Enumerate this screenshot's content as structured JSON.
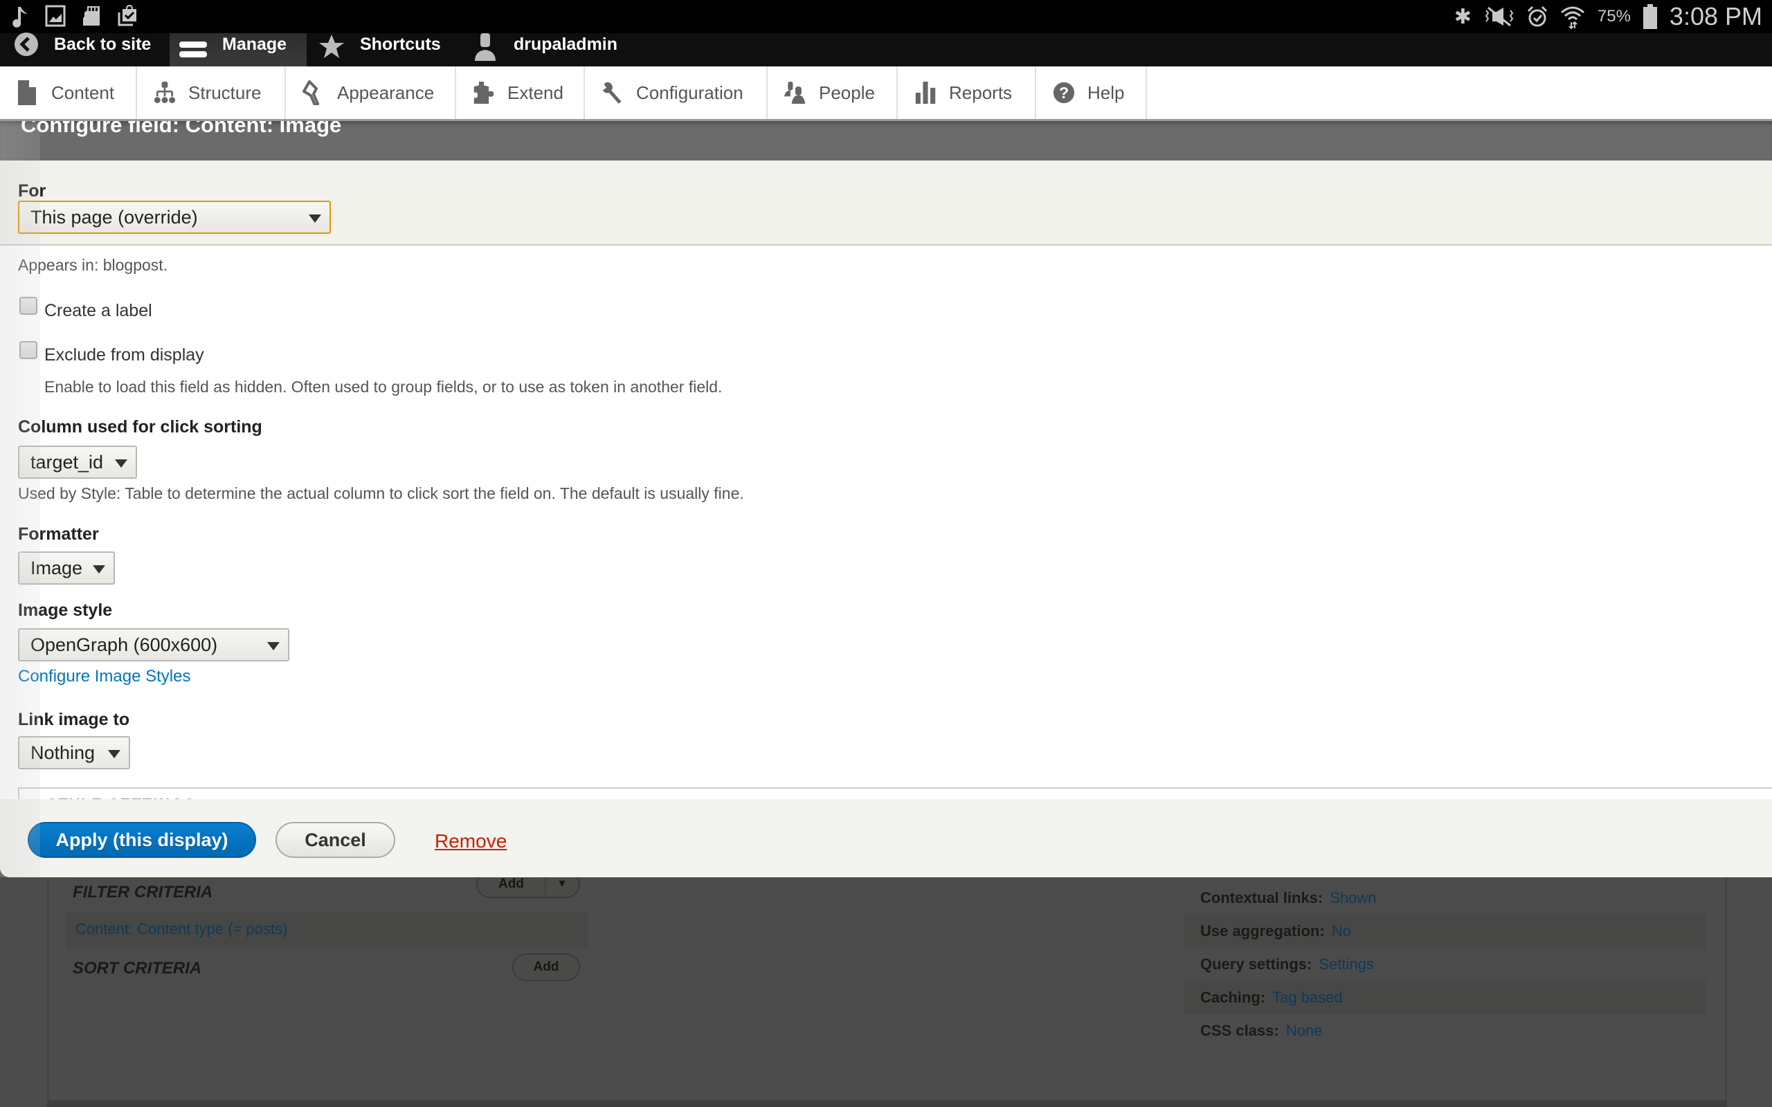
{
  "status_bar": {
    "left_icons": [
      "music-note-icon",
      "gallery-icon",
      "sd-card-icon",
      "clipboard-check-icon"
    ],
    "right_icons": [
      "bluetooth-icon",
      "vibrate-mute-icon",
      "alarm-icon",
      "wifi-icon",
      "battery-icon"
    ],
    "battery": "75%",
    "time": "3:08 PM"
  },
  "toolbar": {
    "back_to_site": "Back to site",
    "manage": "Manage",
    "shortcuts": "Shortcuts",
    "user": "drupaladmin"
  },
  "tray": {
    "tabs": [
      {
        "label": "Content",
        "icon": "file-icon"
      },
      {
        "label": "Structure",
        "icon": "sitemap-icon"
      },
      {
        "label": "Appearance",
        "icon": "paintbrush-icon"
      },
      {
        "label": "Extend",
        "icon": "puzzle-icon"
      },
      {
        "label": "Configuration",
        "icon": "wrench-icon"
      },
      {
        "label": "People",
        "icon": "people-icon"
      },
      {
        "label": "Reports",
        "icon": "bar-chart-icon"
      },
      {
        "label": "Help",
        "icon": "help-icon"
      }
    ]
  },
  "dialog": {
    "title": "Configure field: Content: Image",
    "for_label": "For",
    "for_value": "This page (override)",
    "appears_in": "Appears in: blogpost.",
    "create_label": "Create a label",
    "create_label_checked": false,
    "exclude_display": "Exclude from display",
    "exclude_display_checked": false,
    "exclude_desc": "Enable to load this field as hidden. Often used to group fields, or to use as token in another field.",
    "click_sort_label": "Column used for click sorting",
    "click_sort_value": "target_id",
    "click_sort_desc": "Used by Style: Table to determine the actual column to click sort the field on. The default is usually fine.",
    "formatter_label": "Formatter",
    "formatter_value": "Image",
    "image_style_label": "Image style",
    "image_style_value": "OpenGraph (600x600)",
    "configure_styles_link": "Configure Image Styles",
    "link_image_label": "Link image to",
    "link_image_value": "Nothing",
    "style_settings": "STYLE SETTINGS",
    "buttons": {
      "apply": "Apply (this display)",
      "cancel": "Cancel",
      "remove": "Remove"
    }
  },
  "background": {
    "filter_criteria": {
      "heading": "FILTER CRITERIA",
      "add": "Add",
      "items": [
        "Content: Content type (= posts)"
      ]
    },
    "sort_criteria": {
      "heading": "SORT CRITERIA",
      "add": "Add"
    },
    "settings": [
      {
        "label": "Contextual links:",
        "value": "Shown"
      },
      {
        "label": "Use aggregation:",
        "value": "No"
      },
      {
        "label": "Query settings:",
        "value": "Settings"
      },
      {
        "label": "Caching:",
        "value": "Tag based"
      },
      {
        "label": "CSS class:",
        "value": "None"
      }
    ]
  },
  "colors": {
    "primary_button": "#0071b8",
    "link": "#0074bd",
    "remove_link": "#c72100",
    "focus_border": "#e29700",
    "overlay_bg": "#4c4c4c",
    "dialog_title_bg": "#6b6b6b"
  }
}
